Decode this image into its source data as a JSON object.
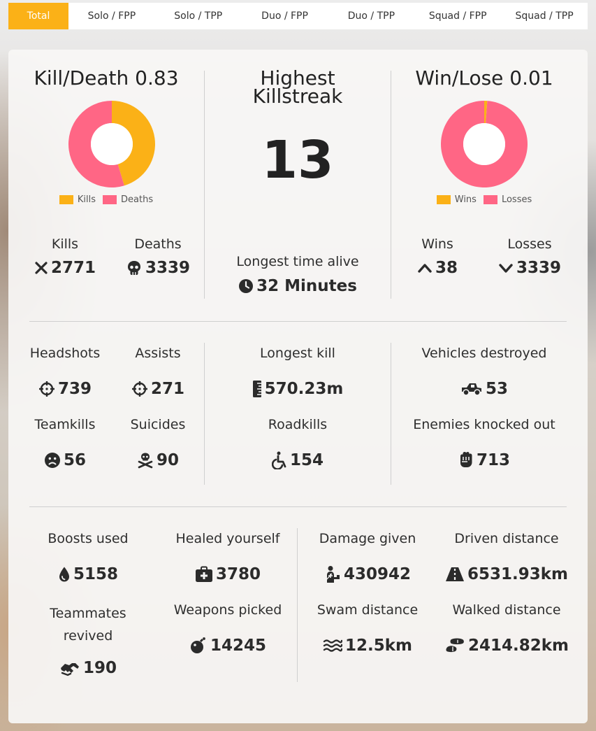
{
  "tabs": [
    "Total",
    "Solo / FPP",
    "Solo / TPP",
    "Duo / FPP",
    "Duo / TPP",
    "Squad / FPP",
    "Squad / TPP"
  ],
  "active_tab": "Total",
  "colors": {
    "accent": "#fbb117",
    "pink": "#ff6685",
    "dark": "#2b2b2b"
  },
  "kd": {
    "title": "Kill/Death 0.83",
    "legend_kills": "Kills",
    "legend_deaths": "Deaths",
    "kills_label": "Kills",
    "kills_value": "2771",
    "deaths_label": "Deaths",
    "deaths_value": "3339",
    "kills_icon": "x-icon",
    "deaths_icon": "skull-icon"
  },
  "killstreak": {
    "title_line1": "Highest",
    "title_line2": "Killstreak",
    "value": "13",
    "longest_time_label": "Longest time alive",
    "longest_time_value": "32 Minutes",
    "clock_icon": "clock-icon"
  },
  "wl": {
    "title": "Win/Lose 0.01",
    "legend_wins": "Wins",
    "legend_losses": "Losses",
    "wins_label": "Wins",
    "wins_value": "38",
    "losses_label": "Losses",
    "losses_value": "3339"
  },
  "stats": {
    "headshots_label": "Headshots",
    "headshots_value": "739",
    "assists_label": "Assists",
    "assists_value": "271",
    "teamkills_label": "Teamkills",
    "teamkills_value": "56",
    "suicides_label": "Suicides",
    "suicides_value": "90",
    "longest_kill_label": "Longest kill",
    "longest_kill_value": "570.23m",
    "roadkills_label": "Roadkills",
    "roadkills_value": "154",
    "vehicles_label": "Vehicles destroyed",
    "vehicles_value": "53",
    "knocked_label": "Enemies knocked out",
    "knocked_value": "713",
    "boosts_label": "Boosts used",
    "boosts_value": "5158",
    "healed_label": "Healed yourself",
    "healed_value": "3780",
    "revived_label_1": "Teammates",
    "revived_label_2": "revived",
    "revived_value": "190",
    "weapons_label": "Weapons picked",
    "weapons_value": "14245",
    "damage_label": "Damage given",
    "damage_value": "430942",
    "driven_label": "Driven distance",
    "driven_value": "6531.93km",
    "swam_label": "Swam distance",
    "swam_value": "12.5km",
    "walked_label": "Walked distance",
    "walked_value": "2414.82km"
  },
  "chart_data": [
    {
      "type": "pie",
      "title": "Kill/Death 0.83",
      "categories": [
        "Kills",
        "Deaths"
      ],
      "values": [
        2771,
        3339
      ],
      "colors": [
        "#fbb117",
        "#ff6685"
      ],
      "legend": "bottom"
    },
    {
      "type": "pie",
      "title": "Win/Lose 0.01",
      "categories": [
        "Wins",
        "Losses"
      ],
      "values": [
        38,
        3339
      ],
      "colors": [
        "#fbb117",
        "#ff6685"
      ],
      "legend": "bottom"
    }
  ]
}
